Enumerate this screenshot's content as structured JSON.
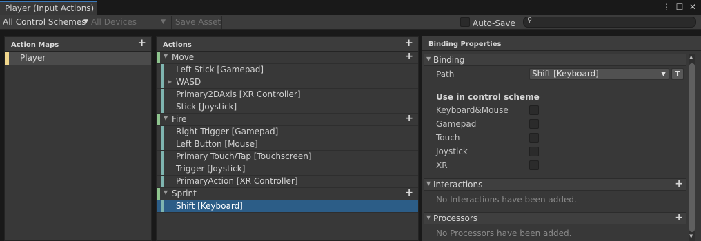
{
  "window": {
    "tab_title": "Player (Input Actions)",
    "icons": [
      "kebab-menu-icon",
      "maximize-icon",
      "close-icon"
    ]
  },
  "toolbar": {
    "control_scheme": "All Control Schemes",
    "devices": "All Devices",
    "save_asset": "Save Asset",
    "auto_save_label": "Auto-Save",
    "auto_save_checked": false,
    "search_placeholder": ""
  },
  "action_maps": {
    "header": "Action Maps",
    "items": [
      {
        "label": "Player",
        "selected": true
      }
    ]
  },
  "actions": {
    "header": "Actions",
    "rows": [
      {
        "kind": "action",
        "label": "Move"
      },
      {
        "kind": "binding",
        "label": "Left Stick [Gamepad]"
      },
      {
        "kind": "binding",
        "label": "WASD",
        "composite": true
      },
      {
        "kind": "binding",
        "label": "Primary2DAxis [XR Controller]"
      },
      {
        "kind": "binding",
        "label": "Stick [Joystick]"
      },
      {
        "kind": "action",
        "label": "Fire"
      },
      {
        "kind": "binding",
        "label": "Right Trigger [Gamepad]"
      },
      {
        "kind": "binding",
        "label": "Left Button [Mouse]"
      },
      {
        "kind": "binding",
        "label": "Primary Touch/Tap [Touchscreen]"
      },
      {
        "kind": "binding",
        "label": "Trigger [Joystick]"
      },
      {
        "kind": "binding",
        "label": "PrimaryAction [XR Controller]"
      },
      {
        "kind": "action",
        "label": "Sprint"
      },
      {
        "kind": "binding",
        "label": "Shift [Keyboard]",
        "selected": true
      }
    ]
  },
  "binding_properties": {
    "header": "Binding Properties",
    "binding_section": "Binding",
    "path_label": "Path",
    "path_value": "Shift [Keyboard]",
    "t_button": "T",
    "scheme_heading": "Use in control scheme",
    "schemes": [
      {
        "label": "Keyboard&Mouse",
        "checked": false
      },
      {
        "label": "Gamepad",
        "checked": false
      },
      {
        "label": "Touch",
        "checked": false
      },
      {
        "label": "Joystick",
        "checked": false
      },
      {
        "label": "XR",
        "checked": false
      }
    ],
    "interactions_section": "Interactions",
    "interactions_empty": "No Interactions have been added.",
    "processors_section": "Processors",
    "processors_empty": "No Processors have been added."
  },
  "colors": {
    "action_map_accent": "#f0d68c",
    "action_accent": "#8fc58f",
    "binding_accent": "#7fb5b0",
    "selection": "#2c5d87",
    "tab_accent": "#3a79bb"
  }
}
